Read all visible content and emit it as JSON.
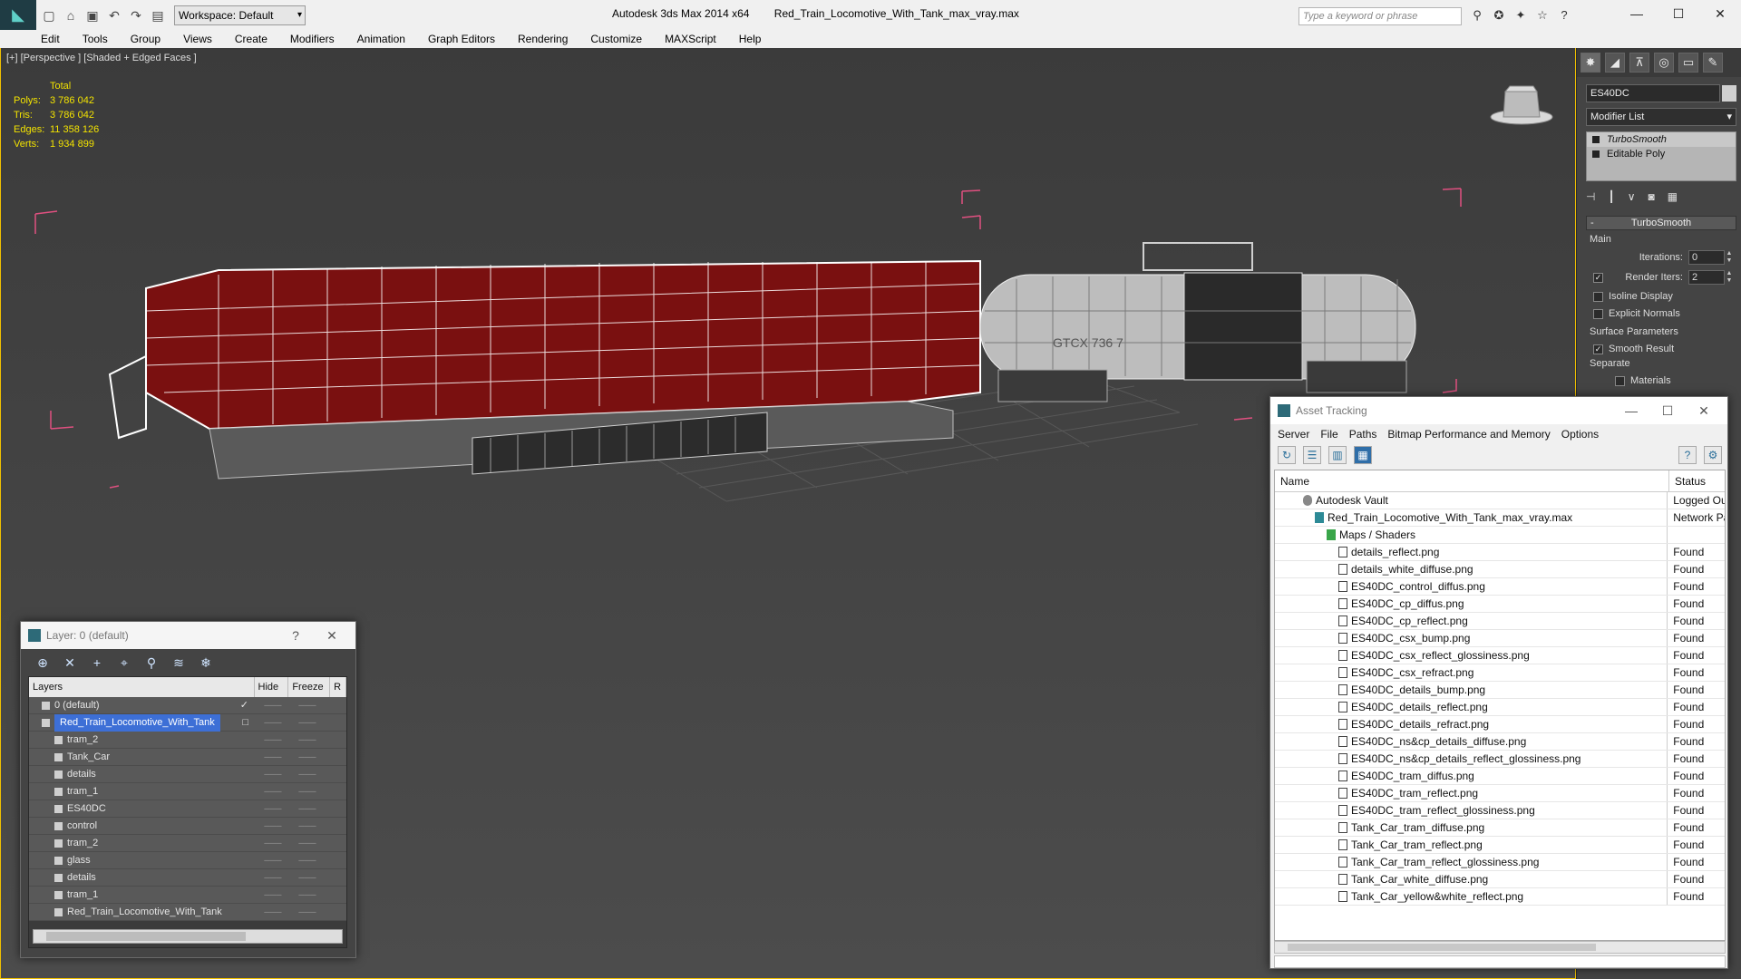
{
  "titlebar": {
    "workspace": "Workspace: Default",
    "app_title": "Autodesk 3ds Max  2014 x64",
    "file_title": "Red_Train_Locomotive_With_Tank_max_vray.max",
    "search_placeholder": "Type a keyword or phrase"
  },
  "menu": [
    "Edit",
    "Tools",
    "Group",
    "Views",
    "Create",
    "Modifiers",
    "Animation",
    "Graph Editors",
    "Rendering",
    "Customize",
    "MAXScript",
    "Help"
  ],
  "viewport": {
    "label": "[+] [Perspective ] [Shaded + Edged Faces ]",
    "stats": {
      "header": "Total",
      "rows": [
        {
          "k": "Polys:",
          "v": "3 786 042"
        },
        {
          "k": "Tris:",
          "v": "3 786 042"
        },
        {
          "k": "Edges:",
          "v": "11 358 126"
        },
        {
          "k": "Verts:",
          "v": "1 934 899"
        }
      ]
    },
    "tank_text": "GTCX 736 7"
  },
  "command_panel": {
    "object_name": "ES40DC",
    "modifier_list": "Modifier List",
    "stack": [
      "TurboSmooth",
      "Editable Poly"
    ],
    "rollout_title": "TurboSmooth",
    "main_label": "Main",
    "iterations_label": "Iterations:",
    "iterations_value": "0",
    "render_iters_label": "Render Iters:",
    "render_iters_value": "2",
    "isoline": "Isoline Display",
    "explicit": "Explicit Normals",
    "surface_params": "Surface Parameters",
    "smooth_result": "Smooth Result",
    "separate": "Separate",
    "materials": "Materials"
  },
  "layer_dialog": {
    "title": "Layer: 0 (default)",
    "help": "?",
    "columns": [
      "Layers",
      "Hide",
      "Freeze",
      "R"
    ],
    "rows": [
      {
        "name": "0 (default)",
        "indent": 1,
        "check": "✓"
      },
      {
        "name": "Red_Train_Locomotive_With_Tank",
        "indent": 1,
        "selected": true,
        "check": "□"
      },
      {
        "name": "tram_2",
        "indent": 2
      },
      {
        "name": "Tank_Car",
        "indent": 2
      },
      {
        "name": "details",
        "indent": 2
      },
      {
        "name": "tram_1",
        "indent": 2
      },
      {
        "name": "ES40DC",
        "indent": 2
      },
      {
        "name": "control",
        "indent": 2
      },
      {
        "name": "tram_2",
        "indent": 2
      },
      {
        "name": "glass",
        "indent": 2
      },
      {
        "name": "details",
        "indent": 2
      },
      {
        "name": "tram_1",
        "indent": 2
      },
      {
        "name": "Red_Train_Locomotive_With_Tank",
        "indent": 2
      }
    ]
  },
  "asset_dialog": {
    "title": "Asset Tracking",
    "menu": [
      "Server",
      "File",
      "Paths",
      "Bitmap Performance and Memory",
      "Options"
    ],
    "columns": {
      "name": "Name",
      "status": "Status"
    },
    "rows": [
      {
        "name": "Autodesk Vault",
        "status": "Logged Out",
        "indent": 1
      },
      {
        "name": "Red_Train_Locomotive_With_Tank_max_vray.max",
        "status": "Network Pa",
        "indent": 2
      },
      {
        "name": "Maps / Shaders",
        "status": "",
        "indent": 3
      },
      {
        "name": "details_reflect.png",
        "status": "Found",
        "indent": 4
      },
      {
        "name": "details_white_diffuse.png",
        "status": "Found",
        "indent": 4
      },
      {
        "name": "ES40DC_control_diffus.png",
        "status": "Found",
        "indent": 4
      },
      {
        "name": "ES40DC_cp_diffus.png",
        "status": "Found",
        "indent": 4
      },
      {
        "name": "ES40DC_cp_reflect.png",
        "status": "Found",
        "indent": 4
      },
      {
        "name": "ES40DC_csx_bump.png",
        "status": "Found",
        "indent": 4
      },
      {
        "name": "ES40DC_csx_reflect_glossiness.png",
        "status": "Found",
        "indent": 4
      },
      {
        "name": "ES40DC_csx_refract.png",
        "status": "Found",
        "indent": 4
      },
      {
        "name": "ES40DC_details_bump.png",
        "status": "Found",
        "indent": 4
      },
      {
        "name": "ES40DC_details_reflect.png",
        "status": "Found",
        "indent": 4
      },
      {
        "name": "ES40DC_details_refract.png",
        "status": "Found",
        "indent": 4
      },
      {
        "name": "ES40DC_ns&cp_details_diffuse.png",
        "status": "Found",
        "indent": 4
      },
      {
        "name": "ES40DC_ns&cp_details_reflect_glossiness.png",
        "status": "Found",
        "indent": 4
      },
      {
        "name": "ES40DC_tram_diffus.png",
        "status": "Found",
        "indent": 4
      },
      {
        "name": "ES40DC_tram_reflect.png",
        "status": "Found",
        "indent": 4
      },
      {
        "name": "ES40DC_tram_reflect_glossiness.png",
        "status": "Found",
        "indent": 4
      },
      {
        "name": "Tank_Car_tram_diffuse.png",
        "status": "Found",
        "indent": 4
      },
      {
        "name": "Tank_Car_tram_reflect.png",
        "status": "Found",
        "indent": 4
      },
      {
        "name": "Tank_Car_tram_reflect_glossiness.png",
        "status": "Found",
        "indent": 4
      },
      {
        "name": "Tank_Car_white_diffuse.png",
        "status": "Found",
        "indent": 4
      },
      {
        "name": "Tank_Car_yellow&white_reflect.png",
        "status": "Found",
        "indent": 4
      }
    ]
  },
  "colors": {
    "viewport_border": "#f0c000",
    "stats_text": "#f3e300",
    "locomotive_fill": "#7a1010",
    "bbox_pink": "#e05080",
    "selection_blue": "#3d6fd6"
  }
}
